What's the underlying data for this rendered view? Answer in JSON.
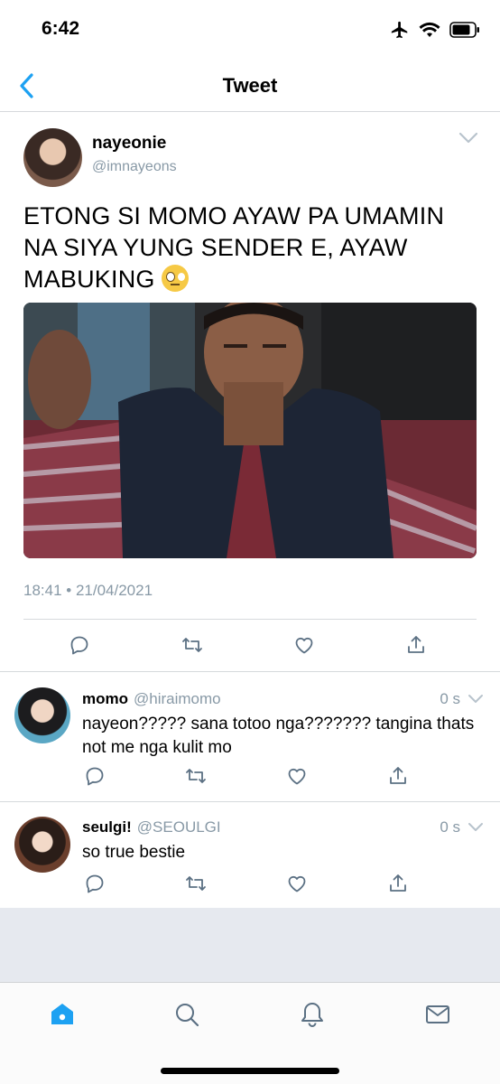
{
  "status_bar": {
    "time": "6:42"
  },
  "nav": {
    "title": "Tweet"
  },
  "tweet": {
    "display_name": "nayeonie",
    "handle": "@imnayeons",
    "text": "ETONG SI MOMO AYAW PA UMAMIN NA SIYA YUNG SENDER E, AYAW MABUKING",
    "emoji": "face-with-rolling-eyes",
    "timestamp": "18:41 • 21/04/2021"
  },
  "replies": [
    {
      "display_name": "momo",
      "handle": "@hiraimomo",
      "time": "0 s",
      "text": "nayeon????? sana totoo nga??????? tangina thats not me nga kulit mo"
    },
    {
      "display_name": "seulgi!",
      "handle": "@SEOULGI",
      "time": "0 s",
      "text": "so true bestie"
    }
  ],
  "icons": {
    "actions": [
      "reply-icon",
      "retweet-icon",
      "like-icon",
      "share-icon"
    ],
    "tabs": [
      "home-icon",
      "search-icon",
      "notifications-icon",
      "messages-icon"
    ]
  },
  "colors": {
    "accent": "#1da1f2",
    "secondary_text": "#8899a6",
    "divider": "#d6d9dc"
  }
}
